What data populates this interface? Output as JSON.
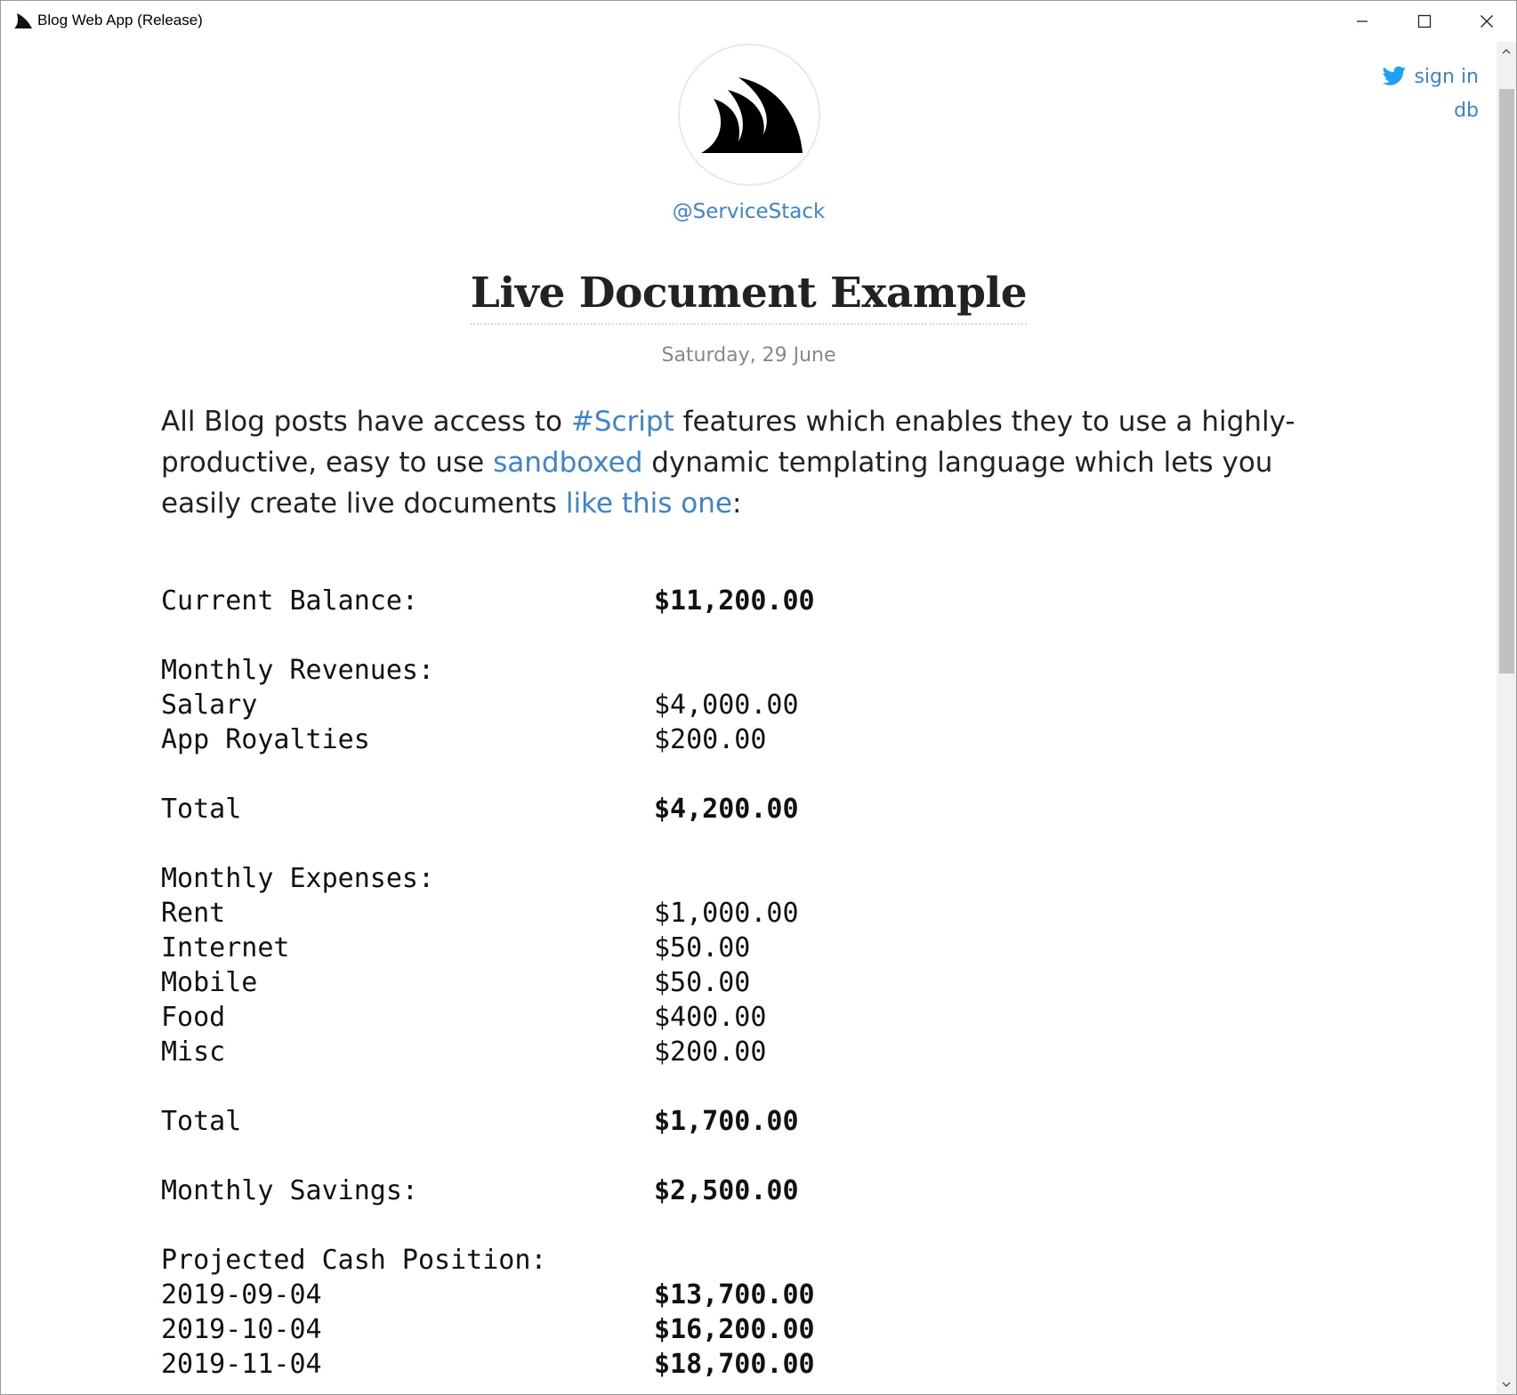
{
  "window": {
    "title": "Blog Web App (Release)",
    "controls": [
      "minimize",
      "maximize",
      "close"
    ]
  },
  "nav": {
    "twitter_icon": "twitter-bird-icon",
    "sign_in": "sign in",
    "db": "db"
  },
  "profile": {
    "handle": "@ServiceStack"
  },
  "post": {
    "title": "Live Document Example",
    "date": "Saturday, 29 June",
    "intro": {
      "t1": "All Blog posts have access to ",
      "link1": "#Script",
      "t2": " features which enables they to use a highly-productive, easy to use ",
      "link2": "sandboxed",
      "t3": " dynamic templating language which lets you easily create live documents ",
      "link3": "like this one",
      "t4": ":"
    }
  },
  "ledger": {
    "current_balance_label": "Current Balance:",
    "current_balance": "$11,200.00",
    "revenues_label": "Monthly Revenues:",
    "revenues": [
      {
        "name": "Salary",
        "amount": "$4,000.00"
      },
      {
        "name": "App Royalties",
        "amount": "$200.00"
      }
    ],
    "revenues_total_label": "Total",
    "revenues_total": "$4,200.00",
    "expenses_label": "Monthly Expenses:",
    "expenses": [
      {
        "name": "Rent",
        "amount": "$1,000.00"
      },
      {
        "name": "Internet",
        "amount": "$50.00"
      },
      {
        "name": "Mobile",
        "amount": "$50.00"
      },
      {
        "name": "Food",
        "amount": "$400.00"
      },
      {
        "name": "Misc",
        "amount": "$200.00"
      }
    ],
    "expenses_total_label": "Total",
    "expenses_total": "$1,700.00",
    "savings_label": "Monthly Savings:",
    "savings": "$2,500.00",
    "projection_label": "Projected Cash Position:",
    "projections": [
      {
        "date": "2019-09-04",
        "amount": "$13,700.00"
      },
      {
        "date": "2019-10-04",
        "amount": "$16,200.00"
      },
      {
        "date": "2019-11-04",
        "amount": "$18,700.00"
      }
    ]
  },
  "colors": {
    "link": "#3d85c6",
    "text": "#222222",
    "muted": "#888888"
  }
}
